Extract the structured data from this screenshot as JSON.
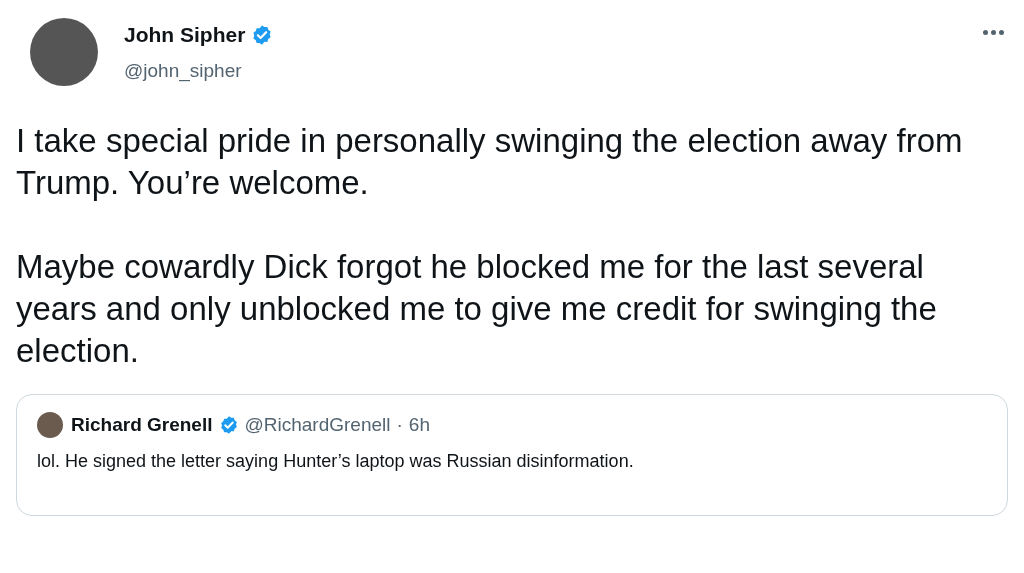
{
  "author": {
    "name": "John Sipher",
    "verified": true,
    "handle": "@john_sipher"
  },
  "paragraphs": [
    "I take special pride in personally swinging the election away from Trump. You’re welcome.",
    "Maybe cowardly Dick forgot he blocked me for the last several years and only unblocked me to give me credit for swinging the election."
  ],
  "quoted_tweet": {
    "name": "Richard Grenell",
    "verified": true,
    "handle": "@RichardGrenell",
    "separator": "·",
    "time": "6h",
    "text": "lol. He signed the letter saying Hunter’s laptop was Russian disinformation."
  }
}
